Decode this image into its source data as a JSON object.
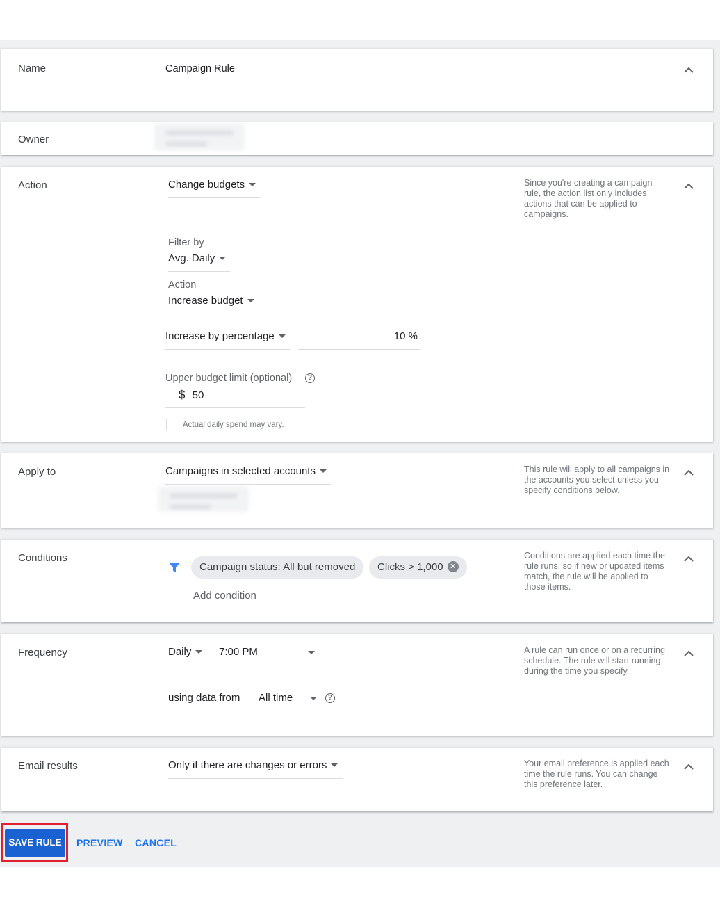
{
  "name_section": {
    "label": "Name",
    "value": "Campaign Rule"
  },
  "owner_section": {
    "label": "Owner"
  },
  "action_section": {
    "label": "Action",
    "action_type": "Change budgets",
    "filter_by_label": "Filter by",
    "filter_by_value": "Avg. Daily",
    "action_label": "Action",
    "action_value": "Increase budget",
    "increase_mode": "Increase by percentage",
    "percentage": "10 %",
    "upper_limit_label": "Upper budget limit (optional)",
    "currency_symbol": "$",
    "upper_limit_value": "50",
    "note": "Actual daily spend may vary.",
    "help": "Since you're creating a campaign rule, the action list only includes actions that can be applied to campaigns."
  },
  "apply_section": {
    "label": "Apply to",
    "value": "Campaigns in selected accounts",
    "help": "This rule will apply to all campaigns in the accounts you select unless you specify conditions below."
  },
  "conditions_section": {
    "label": "Conditions",
    "chips": [
      "Campaign status: All but removed",
      "Clicks > 1,000"
    ],
    "add_condition": "Add condition",
    "help": "Conditions are applied each time the rule runs, so if new or updated items match, the rule will be applied to those items."
  },
  "frequency_section": {
    "label": "Frequency",
    "period": "Daily",
    "time": "7:00 PM",
    "using_label": "using data from",
    "range": "All time",
    "help": "A rule can run once or on a recurring schedule. The rule will start running during the time you specify."
  },
  "email_section": {
    "label": "Email results",
    "value": "Only if there are changes or errors",
    "help": "Your email preference is applied each time the rule runs. You can change this preference later."
  },
  "footer": {
    "save": "SAVE RULE",
    "preview": "PREVIEW",
    "cancel": "CANCEL"
  },
  "colors": {
    "accent": "#1a73e8",
    "save_bg": "#1a62d1",
    "highlight": "#e02030",
    "filter_icon": "#4285f4"
  },
  "icons": [
    "chevron-up-icon",
    "dropdown-arrow-icon",
    "filter-icon",
    "help-circle-icon",
    "chip-remove-icon"
  ]
}
